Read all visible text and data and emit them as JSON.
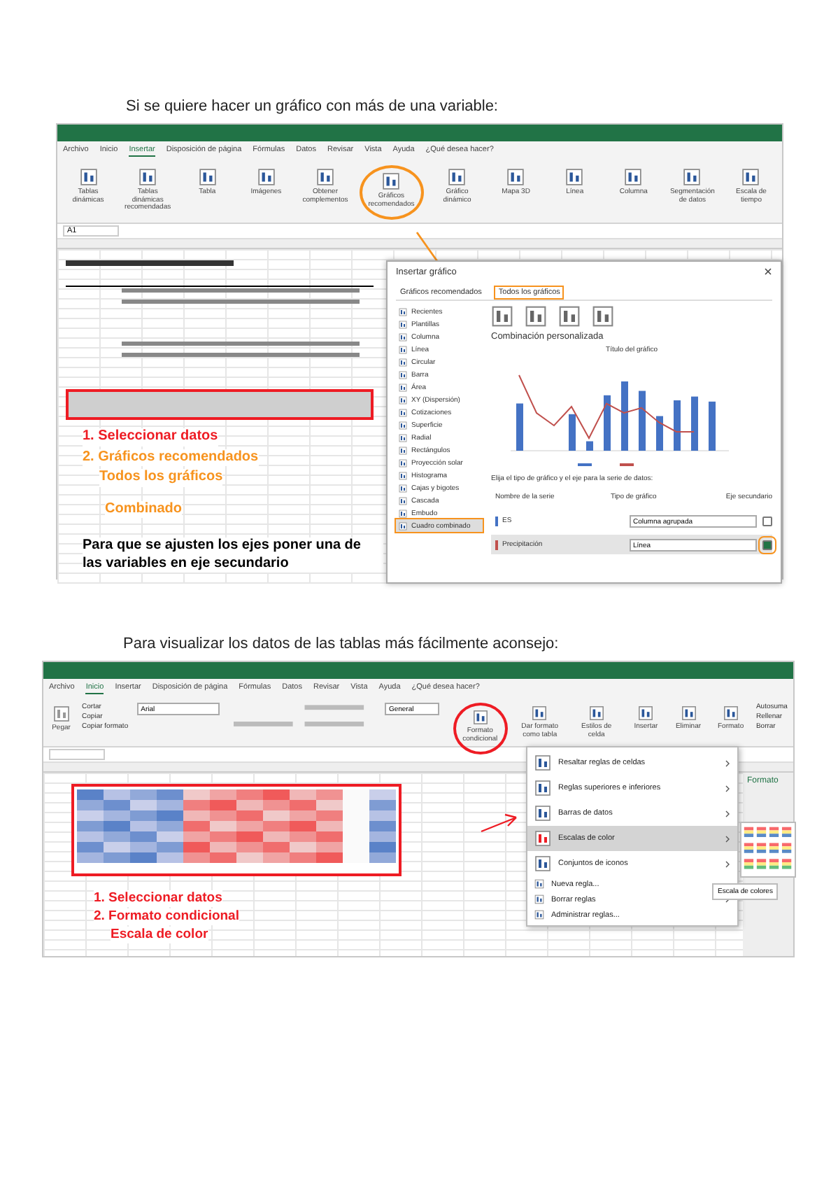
{
  "part1": {
    "heading": "Si se quiere hacer un gráfico con más de una variable:",
    "tabs": [
      {
        "label": "Archivo",
        "selected": false
      },
      {
        "label": "Inicio",
        "selected": false
      },
      {
        "label": "Insertar",
        "selected": true
      },
      {
        "label": "Disposición de página",
        "selected": false
      },
      {
        "label": "Fórmulas",
        "selected": false
      },
      {
        "label": "Datos",
        "selected": false
      },
      {
        "label": "Revisar",
        "selected": false
      },
      {
        "label": "Vista",
        "selected": false
      },
      {
        "label": "Ayuda",
        "selected": false
      },
      {
        "label": "¿Qué desea hacer?",
        "selected": false
      }
    ],
    "ribbon_buttons": [
      {
        "label": "Tablas dinámicas",
        "highlighted": false
      },
      {
        "label": "Tablas dinámicas recomendadas",
        "highlighted": false
      },
      {
        "label": "Tabla",
        "highlighted": false
      },
      {
        "label": "Imágenes",
        "highlighted": false
      },
      {
        "label": "Obtener complementos",
        "highlighted": false
      },
      {
        "label": "Gráficos recomendados",
        "highlighted": true
      },
      {
        "label": "Gráfico dinámico",
        "highlighted": false
      },
      {
        "label": "Mapa 3D",
        "highlighted": false
      },
      {
        "label": "Línea",
        "highlighted": false
      },
      {
        "label": "Columna",
        "highlighted": false
      },
      {
        "label": "Segmentación de datos",
        "highlighted": false
      },
      {
        "label": "Escala de tiempo",
        "highlighted": false
      }
    ],
    "name_box": "A1",
    "dialog": {
      "title": "Insertar gráfico",
      "tabs": [
        {
          "label": "Gráficos recomendados",
          "selected": false
        },
        {
          "label": "Todos los gráficos",
          "selected": true
        }
      ],
      "categories": [
        {
          "label": "Recientes",
          "selected": false
        },
        {
          "label": "Plantillas",
          "selected": false
        },
        {
          "label": "Columna",
          "selected": false
        },
        {
          "label": "Línea",
          "selected": false
        },
        {
          "label": "Circular",
          "selected": false
        },
        {
          "label": "Barra",
          "selected": false
        },
        {
          "label": "Área",
          "selected": false
        },
        {
          "label": "XY (Dispersión)",
          "selected": false
        },
        {
          "label": "Cotizaciones",
          "selected": false
        },
        {
          "label": "Superficie",
          "selected": false
        },
        {
          "label": "Radial",
          "selected": false
        },
        {
          "label": "Rectángulos",
          "selected": false
        },
        {
          "label": "Proyección solar",
          "selected": false
        },
        {
          "label": "Histograma",
          "selected": false
        },
        {
          "label": "Cajas y bigotes",
          "selected": false
        },
        {
          "label": "Cascada",
          "selected": false
        },
        {
          "label": "Embudo",
          "selected": false
        },
        {
          "label": "Cuadro combinado",
          "selected": true
        }
      ],
      "subtitle": "Combinación personalizada",
      "chart_title": "Título del gráfico",
      "prompt": "Elija el tipo de gráfico y el eje para la serie de datos:",
      "columns": [
        "Nombre de la serie",
        "Tipo de gráfico",
        "Eje secundario"
      ],
      "series": [
        {
          "name": "ES",
          "type": "Columna agrupada",
          "secondary_axis": false,
          "color": "#4472c4"
        },
        {
          "name": "Precipitación",
          "type": "Línea",
          "secondary_axis": true,
          "color": "#c0504d"
        }
      ]
    },
    "annotations": [
      {
        "text": "1. Seleccionar datos",
        "color": "#ee1c24"
      },
      {
        "text": "2. Gráficos recomendados",
        "color": "#f7931e"
      },
      {
        "text": "Todos los gráficos",
        "color": "#f7931e"
      },
      {
        "text": "Combinado",
        "color": "#f7931e"
      },
      {
        "text": "Para que se ajusten los ejes poner una de las variables en eje secundario",
        "color": "#000000"
      }
    ]
  },
  "part2": {
    "heading": "Para visualizar los datos de las tablas más fácilmente aconsejo:",
    "tabs": [
      {
        "label": "Archivo",
        "selected": false
      },
      {
        "label": "Inicio",
        "selected": true
      },
      {
        "label": "Insertar",
        "selected": false
      },
      {
        "label": "Disposición de página",
        "selected": false
      },
      {
        "label": "Fórmulas",
        "selected": false
      },
      {
        "label": "Datos",
        "selected": false
      },
      {
        "label": "Revisar",
        "selected": false
      },
      {
        "label": "Vista",
        "selected": false
      },
      {
        "label": "Ayuda",
        "selected": false
      },
      {
        "label": "¿Qué desea hacer?",
        "selected": false
      }
    ],
    "clipboard": [
      "Cortar",
      "Copiar",
      "Copiar formato"
    ],
    "paste": "Pegar",
    "font": "Arial",
    "number_format": "General",
    "ribbon_buttons": [
      {
        "label": "Formato condicional",
        "highlighted": true
      },
      {
        "label": "Dar formato como tabla",
        "highlighted": false
      },
      {
        "label": "Estilos de celda",
        "highlighted": false
      },
      {
        "label": "Insertar",
        "highlighted": false
      },
      {
        "label": "Eliminar",
        "highlighted": false
      },
      {
        "label": "Formato",
        "highlighted": false
      }
    ],
    "editing": [
      "Autosuma",
      "Rellenar",
      "Borrar"
    ],
    "menu": [
      {
        "label": "Resaltar reglas de celdas",
        "selected": false,
        "submenu": true
      },
      {
        "label": "Reglas superiores e inferiores",
        "selected": false,
        "submenu": true
      },
      {
        "label": "Barras de datos",
        "selected": false,
        "submenu": true
      },
      {
        "label": "Escalas de color",
        "selected": true,
        "submenu": true
      },
      {
        "label": "Conjuntos de iconos",
        "selected": false,
        "submenu": true
      },
      {
        "label": "Nueva regla...",
        "selected": false,
        "submenu": false
      },
      {
        "label": "Borrar reglas",
        "selected": false,
        "submenu": true
      },
      {
        "label": "Administrar reglas...",
        "selected": false,
        "submenu": false
      }
    ],
    "tooltip": "Escala de colores",
    "pane_title": "Formato",
    "annotations": [
      {
        "text": "1. Seleccionar datos",
        "color": "#ee1c24"
      },
      {
        "text": "2. Formato condicional",
        "color": "#ee1c24"
      },
      {
        "text": "Escala de color",
        "color": "#ee1c24"
      }
    ]
  }
}
